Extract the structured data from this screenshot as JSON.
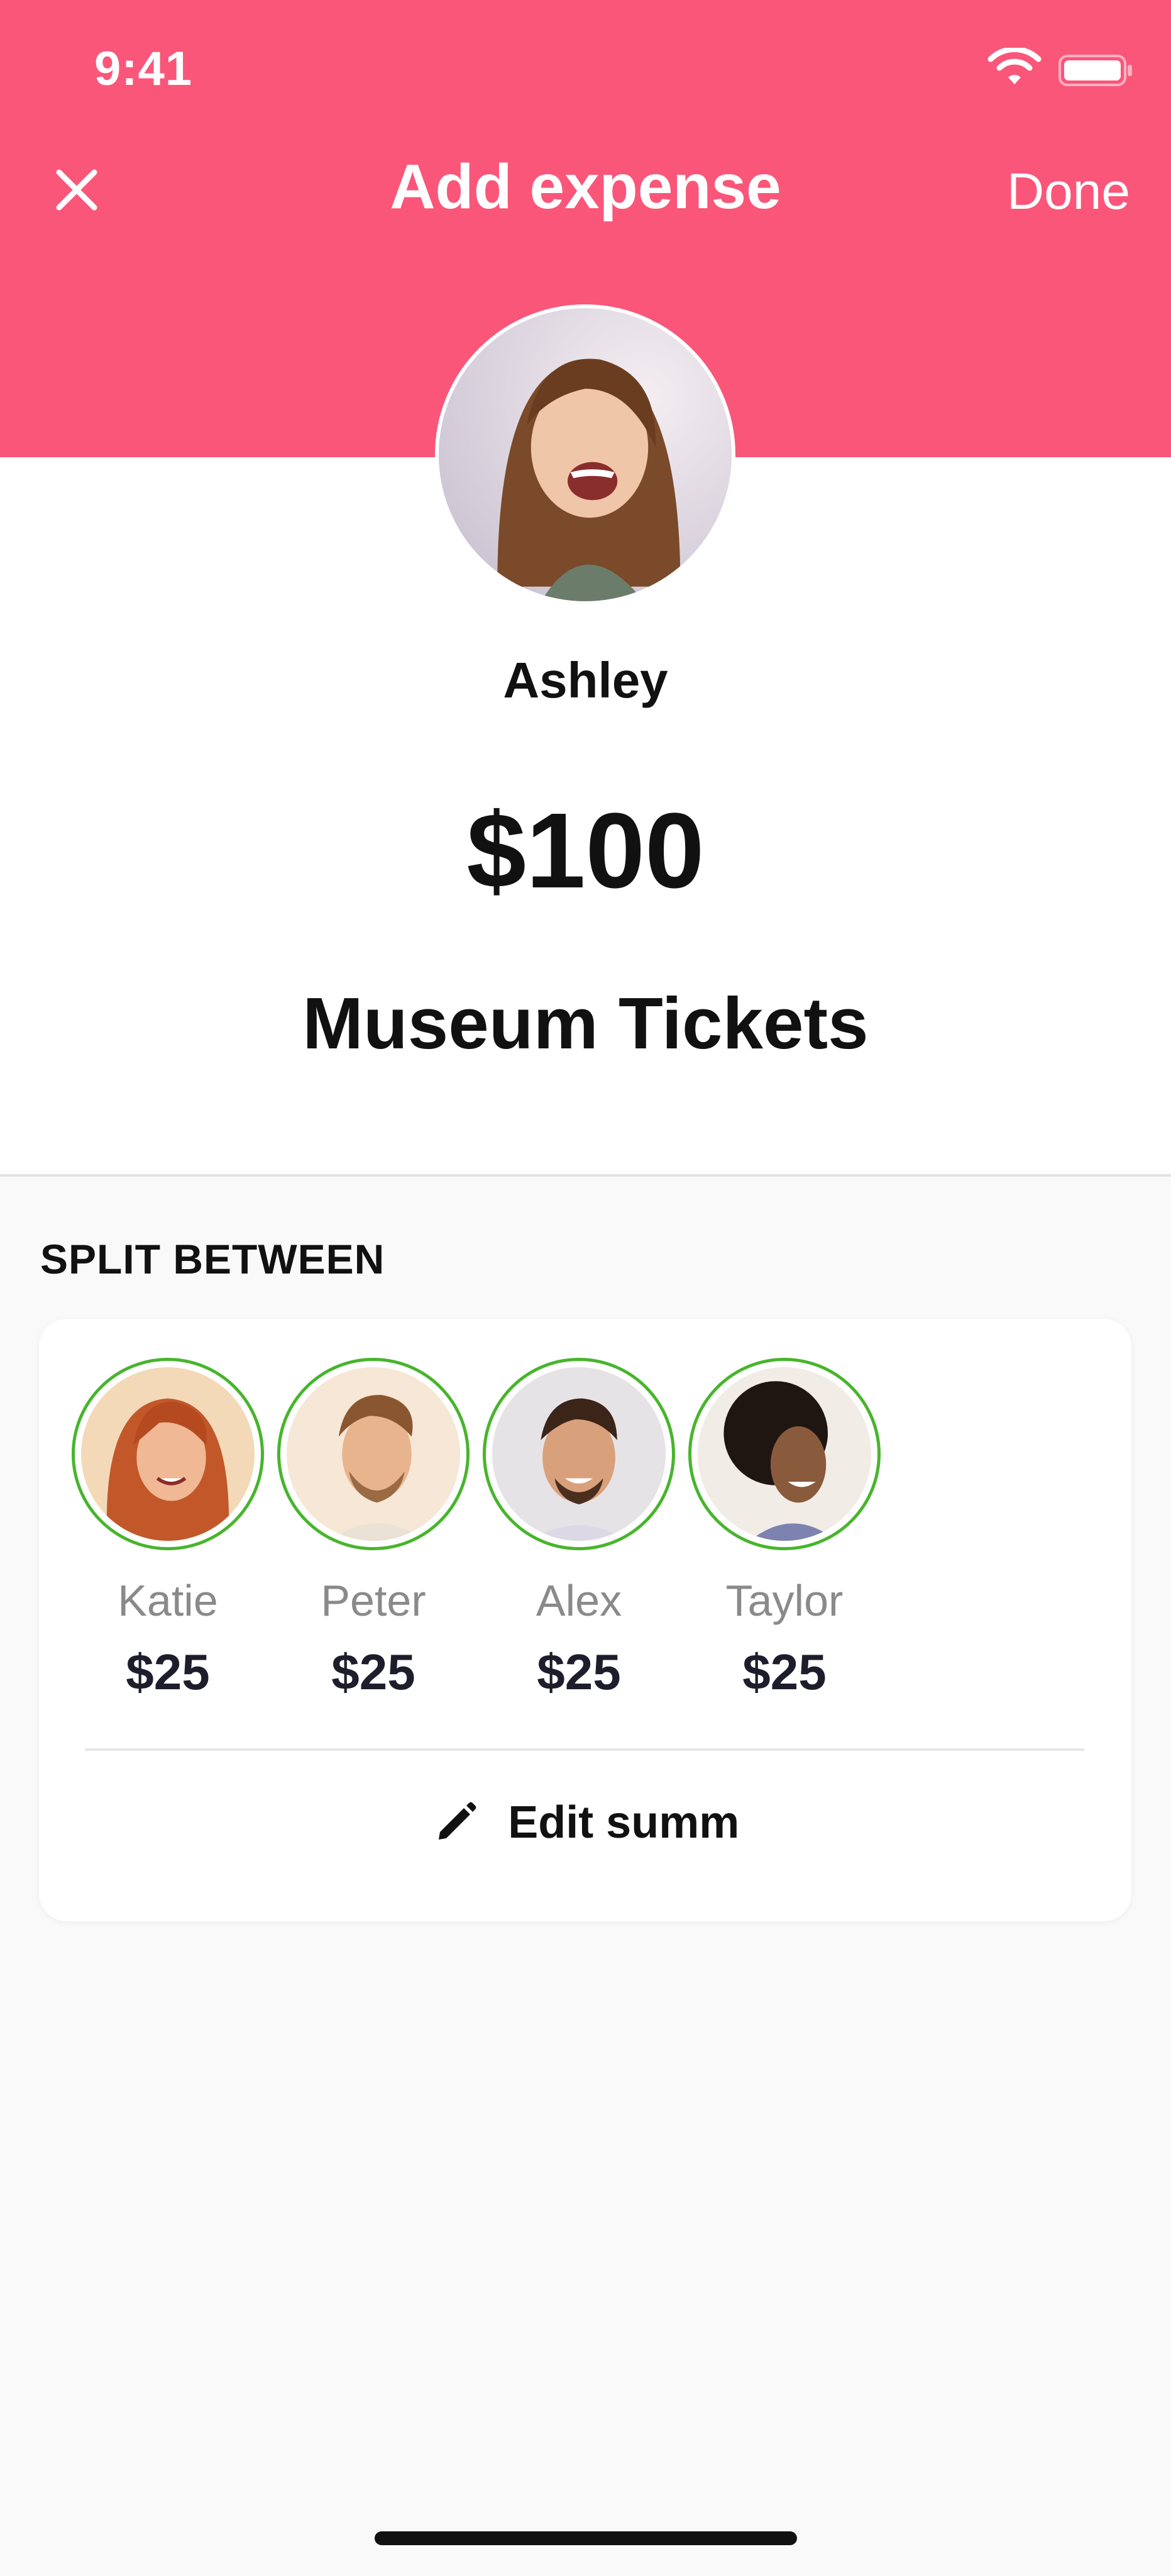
{
  "status_bar": {
    "time": "9:41",
    "wifi_icon": "wifi-icon",
    "battery_icon": "battery-icon"
  },
  "nav": {
    "title": "Add expense",
    "done_label": "Done",
    "close_icon": "close-icon"
  },
  "payer": {
    "name": "Ashley",
    "avatar_icon": "person-avatar"
  },
  "expense": {
    "amount": "$100",
    "title": "Museum Tickets"
  },
  "split": {
    "section_label": "SPLIT BETWEEN",
    "participants": [
      {
        "name": "Katie",
        "amount": "$25"
      },
      {
        "name": "Peter",
        "amount": "$25"
      },
      {
        "name": "Alex",
        "amount": "$25"
      },
      {
        "name": "Taylor",
        "amount": "$25"
      }
    ],
    "edit_label": "Edit summ",
    "edit_icon": "pencil-icon"
  },
  "colors": {
    "header": "#fa5679",
    "selected_ring": "#47b52c",
    "background": "#f9f9f9"
  }
}
